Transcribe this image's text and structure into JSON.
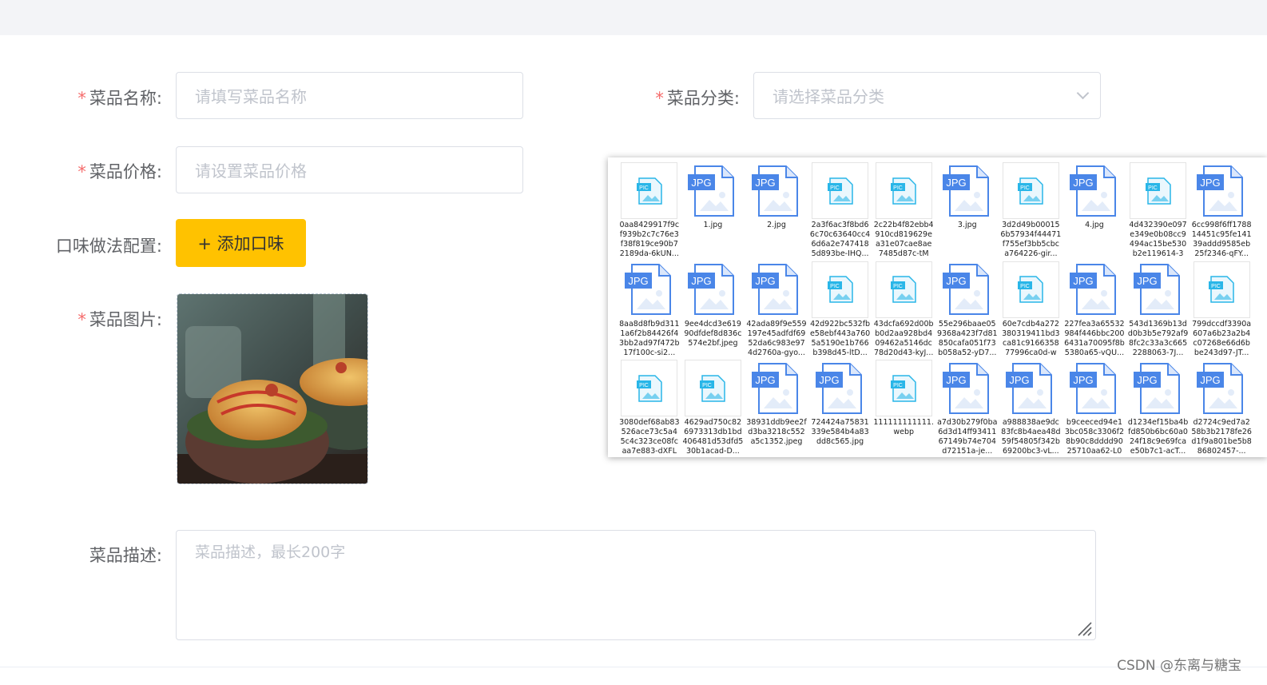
{
  "form": {
    "name": {
      "label": "菜品名称:",
      "placeholder": "请填写菜品名称"
    },
    "category": {
      "label": "菜品分类:",
      "placeholder": "请选择菜品分类"
    },
    "price": {
      "label": "菜品价格:",
      "placeholder": "请设置菜品价格"
    },
    "flavor": {
      "label": "口味做法配置:",
      "button_label": "+ 添加口味"
    },
    "image": {
      "label": "菜品图片:"
    },
    "description": {
      "label": "菜品描述:",
      "placeholder": "菜品描述，最长200字"
    },
    "required_mark": "*"
  },
  "colors": {
    "accent": "#ffc200",
    "required": "#f56c6c",
    "jpg_badge": "#4a86e8",
    "pic_icon": "#29b6e8"
  },
  "file_browser": {
    "files": [
      {
        "type": "pic",
        "name": "0aa8429917f9cf939b2c7c76e3f38f819ce90b72189da-6kUN..."
      },
      {
        "type": "jpg",
        "name": "1.jpg"
      },
      {
        "type": "jpg",
        "name": "2.jpg"
      },
      {
        "type": "pic",
        "name": "2a3f6ac3f8bd66c70c63640cc46d6a2e7474185d893be-IHQ..."
      },
      {
        "type": "pic",
        "name": "2c22b4f82ebb4910cd819629ea31e07cae8ae7485d87c-tMG..."
      },
      {
        "type": "jpg",
        "name": "3.jpg"
      },
      {
        "type": "pic",
        "name": "3d2d49b000156b57934f44471f755ef3bb5cbca764226-gir..."
      },
      {
        "type": "jpg",
        "name": "4.jpg"
      },
      {
        "type": "pic",
        "name": "4d432390e097e349e0b08cc9494ac15be530b2e119614-36..."
      },
      {
        "type": "jpg",
        "name": "6cc998f6ff178814451c95fe14139addd9585eb25f2346-qFY..."
      },
      {
        "type": "jpg",
        "name": "8aa8d8fb9d3111a6f2b84426f43bb2ad97f472b17f100c-si2..."
      },
      {
        "type": "jpg",
        "name": "9ee4dcd3e61990dfdef8d836c574e2bf.jpeg"
      },
      {
        "type": "jpg",
        "name": "42ada89f9e559197e45adfdf6952da6c983e974d2760a-gyo..."
      },
      {
        "type": "pic",
        "name": "42d922bc532fbe58ebf443a7605a5190e1b766b398d45-ltD..."
      },
      {
        "type": "pic",
        "name": "43dcfa692d00bb0d2aa928bd409462a5146dc78d20d43-kyJ..."
      },
      {
        "type": "jpg",
        "name": "55e296baae059368a423f7d81850cafa051f73b058a52-yD7..."
      },
      {
        "type": "pic",
        "name": "60e7cdb4a272380319411bd3ca81c916635877996ca0d-wA..."
      },
      {
        "type": "jpg",
        "name": "227fea3a65532984f446bbc2006431a70095f8b5380a65-vQU..."
      },
      {
        "type": "jpg",
        "name": "543d1369b13dd0b3b5e792af98fc2c33a3c6652288063-7J..."
      },
      {
        "type": "pic",
        "name": "799dccdf3390a607a6b23a2b4c07268e66d6bbe243d97-JT..."
      },
      {
        "type": "pic",
        "name": "3080def68ab83526ace73c5a45c4c323ce08fcaa7e883-dXFLZ..."
      },
      {
        "type": "pic",
        "name": "4629ad750c826973313db1bd406481d53dfd530b1acad-D..."
      },
      {
        "type": "jpg",
        "name": "38931ddb9ee2fd3ba3218c552a5c1352.jpeg"
      },
      {
        "type": "jpg",
        "name": "724424a75831339e584b4a83dd8c565.jpg"
      },
      {
        "type": "pic",
        "name": "111111111111.webp"
      },
      {
        "type": "jpg",
        "name": "a7d30b279f0ba6d3d14ff9341167149b74e704d72151a-je..."
      },
      {
        "type": "jpg",
        "name": "a988838ae9dc83fc8b4aea48d59f54805f342b69200bc3-vL..."
      },
      {
        "type": "jpg",
        "name": "b9ceeced94e13bc058c3306f28b90c8dddd9025710aa62-L0n..."
      },
      {
        "type": "jpg",
        "name": "d1234ef15ba4bfd850b6bc60a024f18c9e69fcae50b7c1-acT..."
      },
      {
        "type": "jpg",
        "name": "d2724c9ed7a258b3b2178fe26d1f9a801be5b886802457-..."
      }
    ],
    "badges": {
      "jpg": "JPG",
      "pic": "PIC"
    }
  },
  "watermark": "CSDN @东离与糖宝"
}
